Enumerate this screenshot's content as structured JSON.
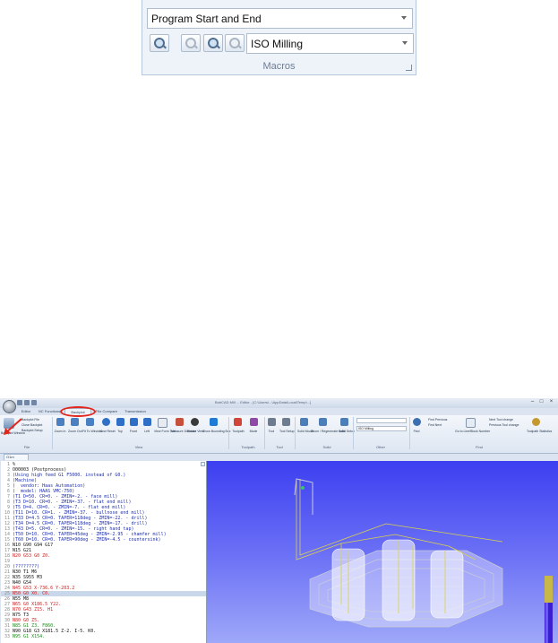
{
  "macros": {
    "program_dropdown": "Program Start and End",
    "mode_dropdown": "ISO Milling",
    "group_label": "Macros",
    "buttons": [
      "macro-tool-icon",
      "zoom-icon",
      "zoom-in-icon",
      "zoom-disabled-icon"
    ]
  },
  "app": {
    "title": "BobCAD Mill ... Editor - [C:\\Users\\...\\AppData\\Local\\Temp\\...]",
    "window_controls": [
      "–",
      "□",
      "×"
    ],
    "tabs": [
      "Editor",
      "NC Functions",
      "Backplot",
      "File Compare",
      "Transmission"
    ],
    "active_tab": "Backplot",
    "ribbon": {
      "file": {
        "items": [
          "Backplot File",
          "Close Backplot",
          "Backplot Setup"
        ],
        "big": "Backplot Window",
        "label": "File"
      },
      "view": {
        "items": [
          "Zoom In",
          "Zoom Out",
          "Fit To Window",
          "View Reset",
          "Top",
          "Front",
          "Left",
          "View Form Tool",
          "Measure Distance",
          "Rotate View",
          "Show Bounding Box"
        ],
        "label": "View"
      },
      "toolpath": {
        "items": [
          "Toolpath",
          "Mode"
        ],
        "label": "Toolpath"
      },
      "tool": {
        "items": [
          "Tool",
          "Tool Setup"
        ],
        "label": "Tool"
      },
      "solid": {
        "items": [
          "Solid Model",
          "Zoom / Regenerate solid",
          "Solid Setup"
        ],
        "label": "Solid"
      },
      "other": {
        "combo": "ISO Milling",
        "label": "Other"
      },
      "find": {
        "items": [
          "Find",
          "Find Previous",
          "Find Next",
          "Go to Line/Block Number",
          "Next Tool change",
          "Previous Tool change",
          "Toolpath Statistics"
        ],
        "label": "Find"
      }
    },
    "doc_tab": "O1m"
  },
  "code_lines": [
    {
      "n": "1",
      "t": "%",
      "c": "c-black"
    },
    {
      "n": "2",
      "t": "O00003 (Postprocess)",
      "c": "c-black"
    },
    {
      "n": "3",
      "t": "(Using high feed G1 F5000. instead of G0.)",
      "c": "c-comment"
    },
    {
      "n": "4",
      "t": "(Machine)",
      "c": "c-comment"
    },
    {
      "n": "5",
      "t": "(  vendor: Haas Automation)",
      "c": "c-comment"
    },
    {
      "n": "6",
      "t": "(  model: HAAS VMC-750)",
      "c": "c-comment"
    },
    {
      "n": "7",
      "t": "(T1 D=50. CR=0. - ZMIN=-2. - face mill)",
      "c": "c-comment"
    },
    {
      "n": "8",
      "t": "(T3 D=10. CR=0. - ZMIN=-37. - flat end mill)",
      "c": "c-comment"
    },
    {
      "n": "9",
      "t": "(T5 D=4. CR=0. - ZMIN=-7. - flat end mill)",
      "c": "c-comment"
    },
    {
      "n": "10",
      "t": "(T11 D=10. CR=1. - ZMIN=-37. - bullnose end mill)",
      "c": "c-comment"
    },
    {
      "n": "11",
      "t": "(T33 D=4.5 CR=0. TAPER=118deg - ZMIN=-22. - drill)",
      "c": "c-comment"
    },
    {
      "n": "12",
      "t": "(T34 D=4.5 CR=0. TAPER=118deg - ZMIN=-17. - drill)",
      "c": "c-comment"
    },
    {
      "n": "13",
      "t": "(T43 D=5. CR=0. - ZMIN=-15. - right hand tap)",
      "c": "c-comment"
    },
    {
      "n": "14",
      "t": "(T50 D=10. CR=0. TAPER=45deg - ZMIN=-2.95 - chamfer mill)",
      "c": "c-comment"
    },
    {
      "n": "15",
      "t": "(T60 D=10. CR=0. TAPER=90deg - ZMIN=-4.5 - countersink)",
      "c": "c-comment"
    },
    {
      "n": "16",
      "t": "N10 G90 G94 G17",
      "c": "c-black"
    },
    {
      "n": "17",
      "t": "N15 G21",
      "c": "c-black"
    },
    {
      "n": "18",
      "t": "N20 G53 G0 Z0.",
      "c": "c-red"
    },
    {
      "n": "19",
      "t": "",
      "c": "c-black"
    },
    {
      "n": "20",
      "t": "(????????)",
      "c": "c-comment"
    },
    {
      "n": "21",
      "t": "N30 T1 M6",
      "c": "c-black"
    },
    {
      "n": "22",
      "t": "N35 S955 M3",
      "c": "c-black"
    },
    {
      "n": "23",
      "t": "N40 G54",
      "c": "c-black"
    },
    {
      "n": "24",
      "t": "N45 G53 X-736.6 Y-203.2",
      "c": "c-red"
    },
    {
      "n": "25",
      "t": "N50 G0 X0. C0.",
      "c": "c-red"
    },
    {
      "n": "26",
      "t": "N55 M8",
      "c": "c-black"
    },
    {
      "n": "27",
      "t": "N65 G0 X186.5 Y22.",
      "c": "c-red"
    },
    {
      "n": "28",
      "t": "N70 G43 Z15. H1",
      "c": "c-red"
    },
    {
      "n": "29",
      "t": "N75 T3",
      "c": "c-black"
    },
    {
      "n": "30",
      "t": "N80 G0 Z5.",
      "c": "c-red"
    },
    {
      "n": "31",
      "t": "N85 G1 Z3. F860.",
      "c": "c-green"
    },
    {
      "n": "32",
      "t": "N90 G18 G3 X181.5 Z-2. I-5. K0.",
      "c": "c-black"
    },
    {
      "n": "33",
      "t": "N95 G1 X154.",
      "c": "c-green"
    }
  ],
  "colors": {
    "accent_red": "#e3261c",
    "viewport_top": "#3c3ff0",
    "viewport_bottom": "#9ea8f8",
    "comment_blue": "#1c2fae"
  }
}
